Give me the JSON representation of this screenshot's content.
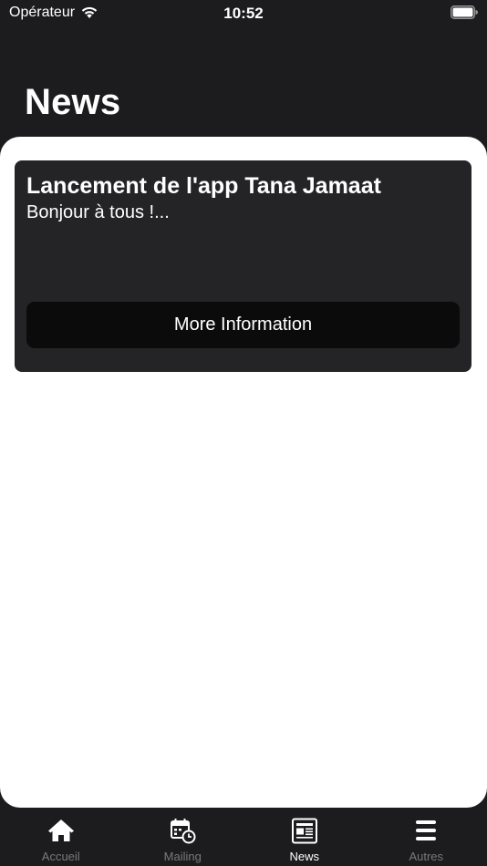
{
  "status_bar": {
    "carrier": "Opérateur",
    "time": "10:52"
  },
  "header": {
    "title": "News"
  },
  "news": [
    {
      "title": "Lancement de l'app Tana Jamaat",
      "excerpt": "Bonjour à tous !...",
      "button_label": "More Information"
    }
  ],
  "tabs": [
    {
      "label": "Accueil",
      "icon": "home-icon",
      "active": false
    },
    {
      "label": "Mailing",
      "icon": "calendar-clock-icon",
      "active": false
    },
    {
      "label": "News",
      "icon": "newspaper-icon",
      "active": true
    },
    {
      "label": "Autres",
      "icon": "menu-icon",
      "active": false
    }
  ],
  "colors": {
    "background": "#1c1c1e",
    "sheet": "#ffffff",
    "card": "#242426",
    "button": "#0b0b0b",
    "tab_inactive": "#7a7a7e",
    "tab_active": "#ffffff"
  }
}
